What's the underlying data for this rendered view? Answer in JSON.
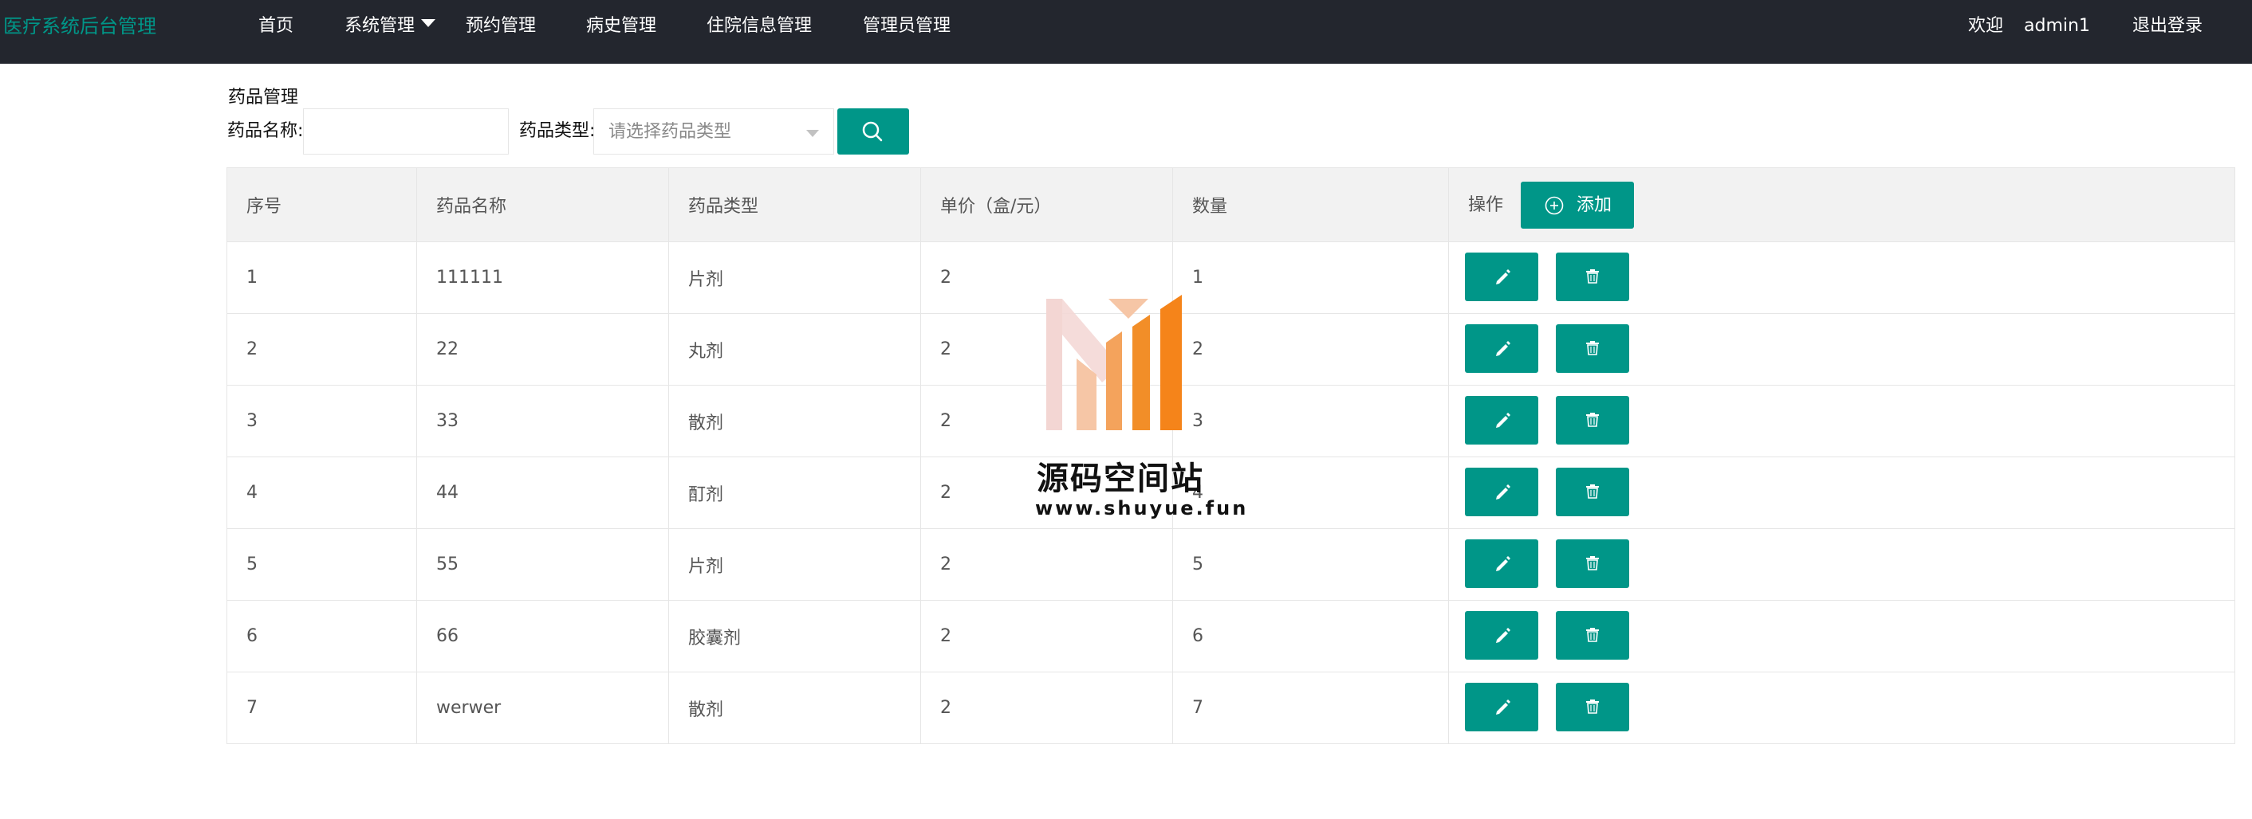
{
  "header": {
    "logo": "医疗系统后台管理",
    "nav": [
      {
        "label": "首页"
      },
      {
        "label": "系统管理",
        "has_dropdown": true
      },
      {
        "label": "预约管理"
      },
      {
        "label": "病史管理"
      },
      {
        "label": "住院信息管理"
      },
      {
        "label": "管理员管理"
      }
    ],
    "welcome": "欢迎",
    "username": "admin1",
    "logout": "退出登录"
  },
  "page": {
    "title": "药品管理",
    "search": {
      "name_label": "药品名称:",
      "name_value": "",
      "type_label": "药品类型:",
      "type_placeholder": "请选择药品类型"
    }
  },
  "table": {
    "columns": [
      "序号",
      "药品名称",
      "药品类型",
      "单价（盒/元）",
      "数量",
      "操作"
    ],
    "add_label": "添加",
    "rows": [
      {
        "id": "1",
        "name": "111111",
        "type": "片剂",
        "price": "2",
        "qty": "1"
      },
      {
        "id": "2",
        "name": "22",
        "type": "丸剂",
        "price": "2",
        "qty": "2"
      },
      {
        "id": "3",
        "name": "33",
        "type": "散剂",
        "price": "2",
        "qty": "3"
      },
      {
        "id": "4",
        "name": "44",
        "type": "酊剂",
        "price": "2",
        "qty": "4"
      },
      {
        "id": "5",
        "name": "55",
        "type": "片剂",
        "price": "2",
        "qty": "5"
      },
      {
        "id": "6",
        "name": "66",
        "type": "胶囊剂",
        "price": "2",
        "qty": "6"
      },
      {
        "id": "7",
        "name": "werwer",
        "type": "散剂",
        "price": "2",
        "qty": "7"
      }
    ]
  },
  "watermark": {
    "title": "源码空间站",
    "url": "www.shuyue.fun"
  },
  "colors": {
    "accent": "#009688",
    "topbar": "#23262e",
    "header_bg": "#f2f2f2"
  }
}
